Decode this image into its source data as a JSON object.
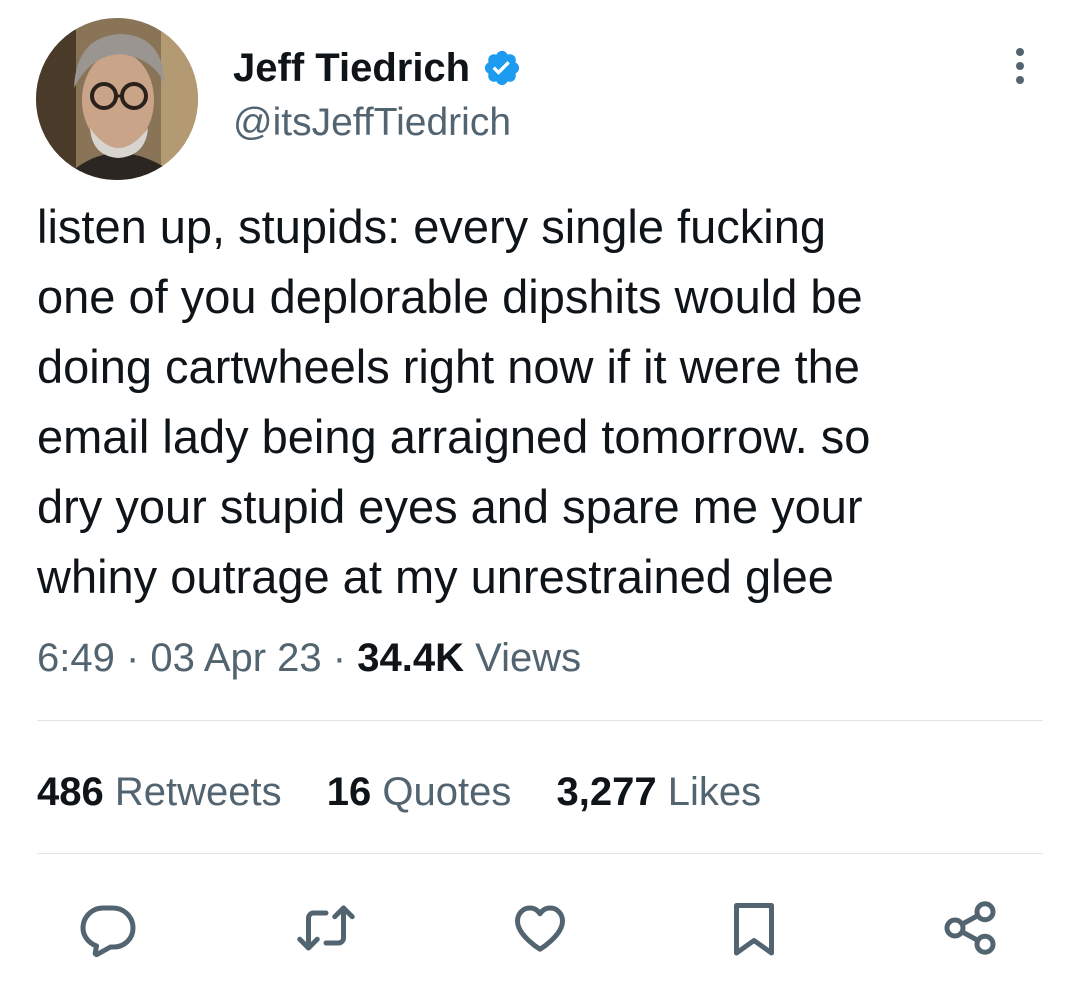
{
  "author": {
    "display_name": "Jeff Tiedrich",
    "handle": "@itsJeffTiedrich",
    "verified": true
  },
  "tweet": {
    "text": "listen up, stupids: every single fucking\none of you deplorable dipshits would be\ndoing cartwheels right now if it were the\nemail lady being arraigned tomorrow. so\ndry your stupid eyes and spare me your\nwhiny outrage at my unrestrained glee",
    "time": "6:49",
    "date": "03 Apr 23",
    "views_count": "34.4K",
    "views_label": "Views"
  },
  "stats": {
    "retweets_count": "486",
    "retweets_label": "Retweets",
    "quotes_count": "16",
    "quotes_label": "Quotes",
    "likes_count": "3,277",
    "likes_label": "Likes"
  },
  "colors": {
    "text_primary": "#0f1419",
    "text_secondary": "#536471",
    "verified_blue": "#1d9bf0",
    "divider": "#dfe4e8"
  },
  "icons": {
    "more": "more-options-icon",
    "reply": "reply-icon",
    "retweet": "retweet-icon",
    "like": "heart-icon",
    "bookmark": "bookmark-icon",
    "share": "share-icon"
  }
}
